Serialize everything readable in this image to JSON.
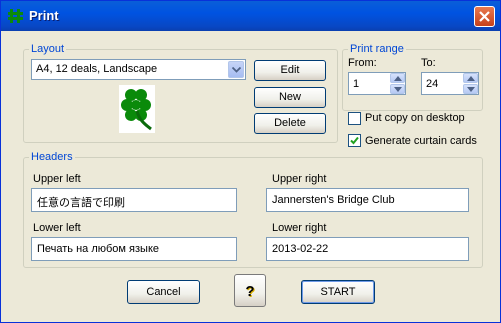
{
  "window": {
    "title": "Print"
  },
  "layout": {
    "legend": "Layout",
    "selected": "A4, 12 deals, Landscape",
    "edit_label": "Edit",
    "new_label": "New",
    "delete_label": "Delete"
  },
  "print_range": {
    "legend": "Print range",
    "from_label": "From:",
    "from_value": "1",
    "to_label": "To:",
    "to_value": "24"
  },
  "options": {
    "copy_desktop_label": "Put copy on desktop",
    "copy_desktop_checked": false,
    "curtain_label": "Generate curtain cards",
    "curtain_checked": true
  },
  "headers": {
    "legend": "Headers",
    "upper_left_label": "Upper left",
    "upper_left_value": "任意の言語で印刷",
    "upper_right_label": "Upper right",
    "upper_right_value": "Jannersten's Bridge Club",
    "lower_left_label": "Lower left",
    "lower_left_value": "Печать на любом языке",
    "lower_right_label": "Lower right",
    "lower_right_value": "2013-02-22"
  },
  "footer": {
    "cancel_label": "Cancel",
    "help_label": "?",
    "start_label": "START"
  },
  "icons": {
    "title": "clover-icon",
    "preview": "four-leaf-clover-icon",
    "close": "close-icon",
    "help": "question-mark-icon"
  },
  "colors": {
    "title_bar": "#0053e1",
    "group_label": "#0046d5",
    "dialog_bg": "#ece9d8",
    "clover": "#0a8a0a"
  }
}
